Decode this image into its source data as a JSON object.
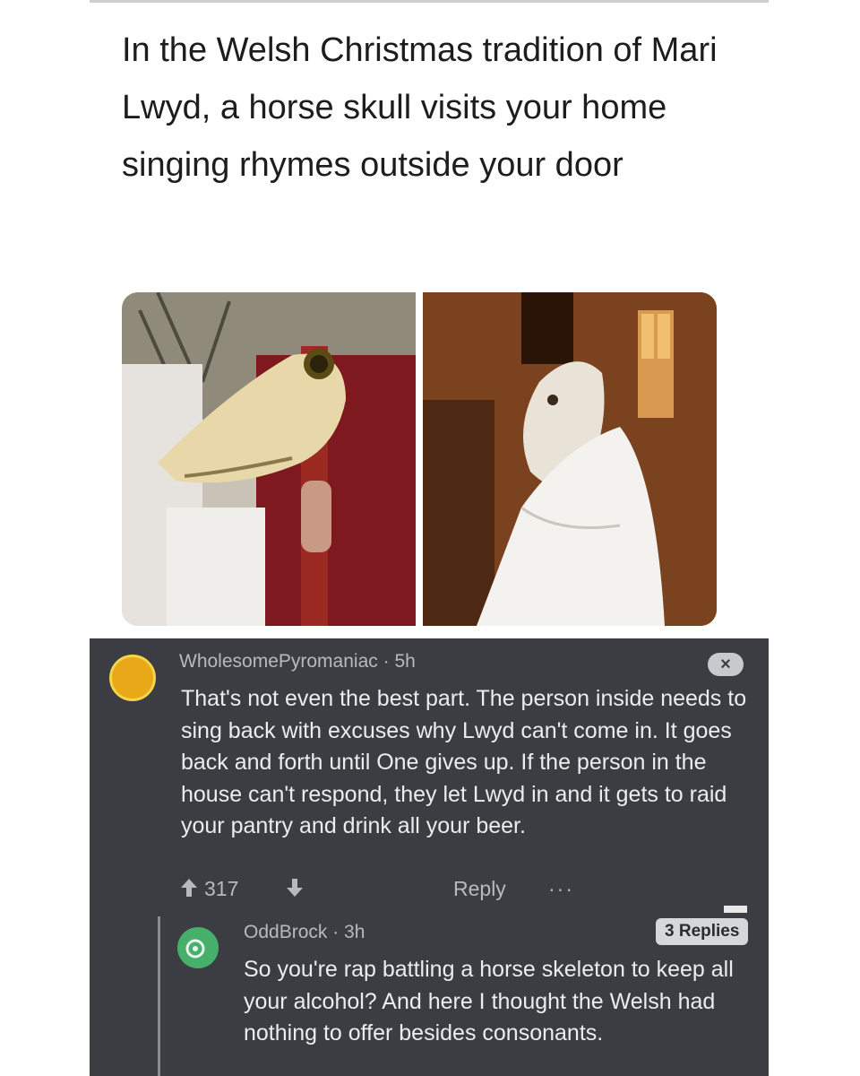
{
  "post": {
    "text": "In the Welsh Christmas tradition of Mari Lwyd, a horse skull visits your home singing rhymes outside your door"
  },
  "comments": [
    {
      "author": "WholesomePyromaniac",
      "age": "5h",
      "body": "That's not even the best part. The person inside needs to sing back with excuses why Lwyd can't come in. It goes back and forth until One gives up. If the person in the house can't respond, they let Lwyd in and it gets to raid your pantry and drink all your beer.",
      "score": "317",
      "reply_label": "Reply",
      "more_label": "···",
      "close_label": "×"
    },
    {
      "author": "OddBrock",
      "age": "3h",
      "replies": "3 Replies",
      "body": "So you're rap battling a horse skeleton to keep all your alcohol? And here I thought the Welsh had nothing to offer besides consonants."
    }
  ],
  "icons": {
    "upvote": "arrow-up-icon",
    "downvote": "arrow-down-icon"
  },
  "colors": {
    "comment_bg": "#3c3d42",
    "avatar_wp": "#e8a817",
    "avatar_ob": "#46b06b"
  }
}
